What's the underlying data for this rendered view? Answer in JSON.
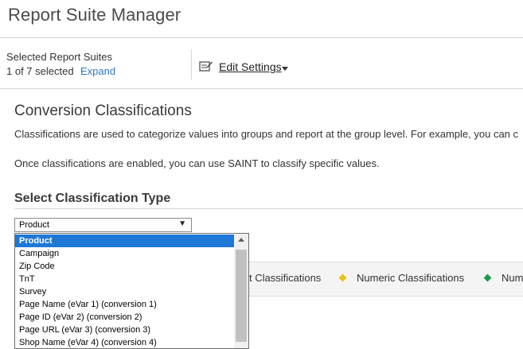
{
  "header": {
    "title": "Report Suite Manager"
  },
  "toolbar": {
    "selected_label": "Selected Report Suites",
    "selected_count": "1 of 7 selected",
    "expand_label": "Expand",
    "edit_settings_label": "Edit Settings",
    "edit_icon": "edit-document-icon",
    "dropdown_icon": "chevron-down-icon"
  },
  "section": {
    "title": "Conversion Classifications",
    "description_1": "Classifications are used to categorize values into groups and report at the group level. For example, you can c",
    "description_2": "Once classifications are enabled, you can use SAINT to classify specific values."
  },
  "classification_type": {
    "heading": "Select Classification Type",
    "selected_value": "Product",
    "arrow": "▼",
    "options": [
      "Product",
      "Campaign",
      "Zip Code",
      "TnT",
      "Survey",
      "Page Name (eVar 1) (conversion 1)",
      "Page ID (eVar 2) (conversion 2)",
      "Page URL (eVar 3) (conversion 3)",
      "Shop Name (eVar 4) (conversion 4)"
    ]
  },
  "legend": {
    "text_label": "t Classifications",
    "numeric_label": "Numeric Classifications",
    "third_label": "Num",
    "numeric_color": "#e8c21a",
    "third_color": "#1f9a4a"
  },
  "colors": {
    "accent": "#1e78d6",
    "link": "#2d78c8"
  }
}
